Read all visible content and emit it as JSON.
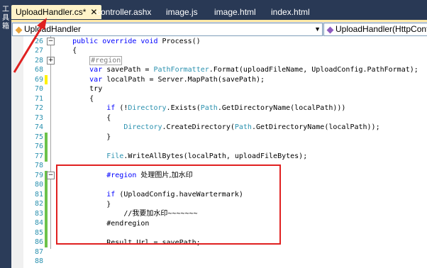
{
  "toolwindow": {
    "label": "工具箱"
  },
  "tabs": [
    {
      "label": "UploadHandler.cs*",
      "active": true
    },
    {
      "label": "controller.ashx"
    },
    {
      "label": "image.js"
    },
    {
      "label": "image.html"
    },
    {
      "label": "index.html"
    }
  ],
  "navbar": {
    "left_combo": "UploadHandler",
    "right_combo": "UploadHandler(HttpContext"
  },
  "lines": [
    {
      "num": "26",
      "code": "    public override void Process()"
    },
    {
      "num": "27",
      "code": "    {"
    },
    {
      "num": "28",
      "code": "        #region"
    },
    {
      "num": "68",
      "code": "        var savePath = PathFormatter.Format(uploadFileName, UploadConfig.PathFormat);"
    },
    {
      "num": "69",
      "code": "        var localPath = Server.MapPath(savePath);"
    },
    {
      "num": "70",
      "code": "        try"
    },
    {
      "num": "71",
      "code": "        {"
    },
    {
      "num": "72",
      "code": "            if (!Directory.Exists(Path.GetDirectoryName(localPath)))"
    },
    {
      "num": "73",
      "code": "            {"
    },
    {
      "num": "74",
      "code": "                Directory.CreateDirectory(Path.GetDirectoryName(localPath));"
    },
    {
      "num": "75",
      "code": "            }"
    },
    {
      "num": "76",
      "code": ""
    },
    {
      "num": "77",
      "code": "            File.WriteAllBytes(localPath, uploadFileBytes);"
    },
    {
      "num": "78",
      "code": ""
    },
    {
      "num": "79",
      "code": "            #region 处理图片,加水印"
    },
    {
      "num": "80",
      "code": ""
    },
    {
      "num": "81",
      "code": "            if (UploadConfig.haveWartermark)"
    },
    {
      "num": "82",
      "code": "            {"
    },
    {
      "num": "83",
      "code": "                //我要加水印~~~~~~~"
    },
    {
      "num": "84",
      "code": "            }"
    },
    {
      "num": "85",
      "code": ""
    },
    {
      "num": "86",
      "code": "            #endregion"
    },
    {
      "num": "87",
      "code": ""
    },
    {
      "num": "88",
      "code": "            Result.Url = savePath;"
    }
  ],
  "colors": {
    "tab_bg": "#293955",
    "active_tab": "#fff3c9",
    "keyword": "#0000ff",
    "type": "#2b91af",
    "comment": "#008000",
    "change_bar": "#6cc24a",
    "highlight_box": "#e02020"
  }
}
